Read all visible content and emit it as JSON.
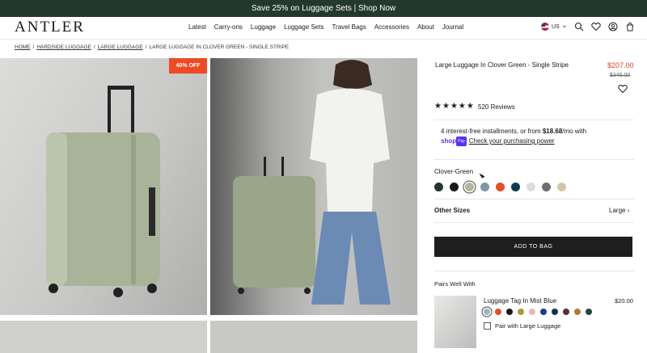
{
  "promo": {
    "text": "Save 25% on Luggage Sets | Shop Now"
  },
  "brand": {
    "logo": "ANTLER"
  },
  "menu": [
    "Latest",
    "Carry-ons",
    "Luggage",
    "Luggage Sets",
    "Travel Bags",
    "Accessories",
    "About",
    "Journal"
  ],
  "region": {
    "label": "US"
  },
  "breadcrumb": {
    "home": "HOME",
    "cat": "HARDSIDE LUGGAGE",
    "sub": "LARGE LUGGAGE",
    "current": "LARGE LUGGAGE IN CLOVER GREEN - SINGLE STRIPE",
    "sep": "/"
  },
  "gallery": {
    "badge": "40% OFF"
  },
  "product": {
    "title": "Large Luggage In Clover Green - Single Stripe",
    "price": "$207.00",
    "old_price": "$345.00",
    "rating": 5,
    "reviews": "520 Reviews",
    "install_prefix": "4 interest-free installments, or from ",
    "install_amount": "$18.68",
    "install_suffix": "/mo with",
    "shoppay": "shop",
    "shoppay_badge": "Pay",
    "install_link": "Check your purchasing power",
    "color_label": "Clover-Green",
    "swatches": [
      "#22362b",
      "#1b1b1b",
      "#b7b59a",
      "#7b9aa9",
      "#e0512d",
      "#11394f",
      "#dcdcd8",
      "#6f6f6f",
      "#d4c6a6"
    ],
    "selected_swatch": 2,
    "other_label": "Other Sizes",
    "other_value": "Large",
    "add_to_bag": "ADD TO BAG"
  },
  "pairs": {
    "heading": "Pairs Well With",
    "item_title": "Luggage Tag In Mist Blue",
    "item_price": "$20.00",
    "swatches": [
      "#9fb3bd",
      "#e0512d",
      "#1b1b1b",
      "#a89a3a",
      "#e8b9b1",
      "#1c3e8a",
      "#0f3550",
      "#5c2a3a",
      "#b07a3a",
      "#22483a"
    ],
    "checkbox_label": "Pair with Large Luggage"
  },
  "icons": {
    "search": "search-icon",
    "wishlist": "heart-icon",
    "account": "user-icon",
    "cart": "bag-icon",
    "chevron": "chevron-down-icon"
  }
}
